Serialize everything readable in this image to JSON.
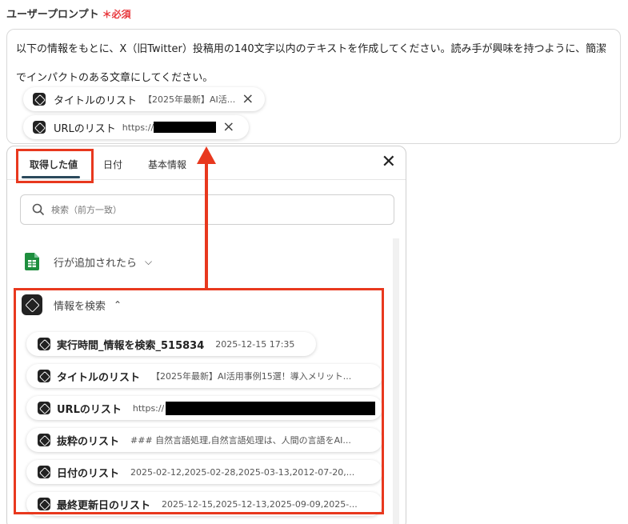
{
  "field": {
    "label": "ユーザープロンプト",
    "required": "＊必須"
  },
  "prompt": {
    "text": "以下の情報をもとに、X（旧Twitter）投稿用の140文字以内のテキストを作成してください。読み手が興味を持つように、簡潔でインパクトのある文章にしてください。",
    "chips": [
      {
        "name": "タイトルのリスト",
        "value": "【2025年最新】AI活..."
      },
      {
        "name": "URLのリスト",
        "value": "https://"
      }
    ]
  },
  "dropdown": {
    "tabs": [
      "取得した値",
      "日付",
      "基本情報"
    ],
    "search_placeholder": "検索（前方一致）",
    "groups": [
      {
        "title": "行が追加されたら",
        "icon": "google-sheets-icon"
      },
      {
        "title": "情報を検索",
        "icon": "yoom-app-icon"
      }
    ],
    "rows": [
      {
        "name": "実行時間_情報を検索_515834",
        "value": "2025-12-15 17:35"
      },
      {
        "name": "タイトルのリスト",
        "value": "【2025年最新】AI活用事例15選！導入メリット..."
      },
      {
        "name": "URLのリスト",
        "value": "https://"
      },
      {
        "name": "抜粋のリスト",
        "value": "### 自然言語処理,自然言語処理は、人間の言語をAI..."
      },
      {
        "name": "日付のリスト",
        "value": "2025-02-12,2025-02-28,2025-03-13,2012-07-20,..."
      },
      {
        "name": "最終更新日のリスト",
        "value": "2025-12-15,2025-12-13,2025-09-09,2025-..."
      }
    ]
  },
  "colors": {
    "highlight": "#e8381e",
    "required": "#e8383d",
    "tab_underline": "#2b4a5c",
    "sheets": "#1e8e3e"
  }
}
